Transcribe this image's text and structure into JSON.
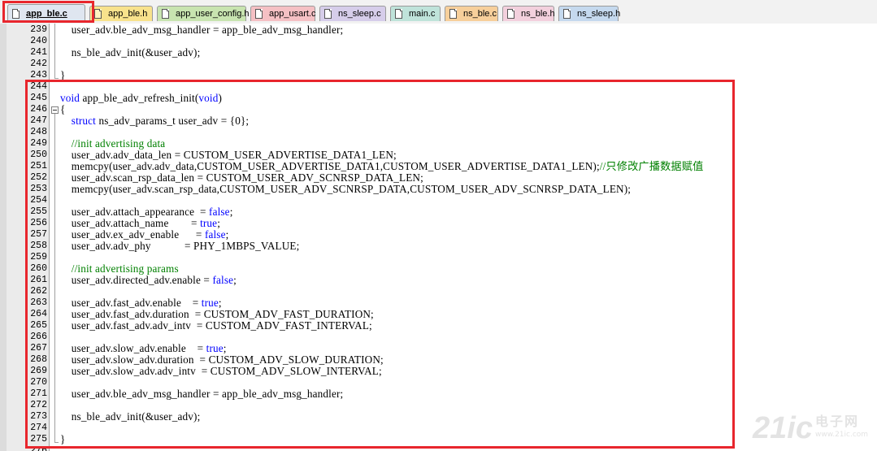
{
  "tabs": [
    {
      "label": "app_ble.c",
      "color": "#dfe6f0",
      "icon_color": "#ffffff",
      "active": true
    },
    {
      "label": "app_ble.h",
      "color": "#f8e28c",
      "icon_color": "#fff3c0",
      "active": false
    },
    {
      "label": "app_user_config.h",
      "color": "#c8e4b0",
      "icon_color": "#ffffff",
      "active": false
    },
    {
      "label": "app_usart.c",
      "color": "#f5c0c4",
      "icon_color": "#ffffff",
      "active": false
    },
    {
      "label": "ns_sleep.c",
      "color": "#d6cdea",
      "icon_color": "#ffffff",
      "active": false
    },
    {
      "label": "main.c",
      "color": "#bfe3da",
      "icon_color": "#ffffff",
      "active": false
    },
    {
      "label": "ns_ble.c",
      "color": "#f7cf9b",
      "icon_color": "#ffffff",
      "active": false
    },
    {
      "label": "ns_ble.h",
      "color": "#f3d0dd",
      "icon_color": "#ffffff",
      "active": false
    },
    {
      "label": "ns_sleep.h",
      "color": "#c5d9ee",
      "icon_color": "#ffffff",
      "active": false
    }
  ],
  "lines": [
    {
      "n": "239",
      "segs": [
        {
          "t": "    user_adv.ble_adv_msg_handler = app_ble_adv_msg_handler;",
          "c": "pl"
        }
      ]
    },
    {
      "n": "240",
      "segs": []
    },
    {
      "n": "241",
      "segs": [
        {
          "t": "    ns_ble_adv_init(&user_adv);",
          "c": "pl"
        }
      ]
    },
    {
      "n": "242",
      "segs": []
    },
    {
      "n": "243",
      "segs": [
        {
          "t": "}",
          "c": "pl"
        }
      ]
    },
    {
      "n": "244",
      "segs": []
    },
    {
      "n": "245",
      "segs": [
        {
          "t": "void",
          "c": "kw"
        },
        {
          "t": " app_ble_adv_refresh_init(",
          "c": "pl"
        },
        {
          "t": "void",
          "c": "kw"
        },
        {
          "t": ")",
          "c": "pl"
        }
      ]
    },
    {
      "n": "246",
      "segs": [
        {
          "t": "{",
          "c": "pl"
        }
      ]
    },
    {
      "n": "247",
      "segs": [
        {
          "t": "    ",
          "c": "pl"
        },
        {
          "t": "struct",
          "c": "kw"
        },
        {
          "t": " ns_adv_params_t user_adv = {0};",
          "c": "pl"
        }
      ]
    },
    {
      "n": "248",
      "segs": []
    },
    {
      "n": "249",
      "segs": [
        {
          "t": "    //init advertising data",
          "c": "cm"
        }
      ]
    },
    {
      "n": "250",
      "segs": [
        {
          "t": "    user_adv.adv_data_len = CUSTOM_USER_ADVERTISE_DATA1_LEN;",
          "c": "pl"
        }
      ]
    },
    {
      "n": "251",
      "segs": [
        {
          "t": "    memcpy(user_adv.adv_data,CUSTOM_USER_ADVERTISE_DATA1,CUSTOM_USER_ADVERTISE_DATA1_LEN);",
          "c": "pl"
        },
        {
          "t": "//只修改广播数据赋值",
          "c": "cm"
        }
      ]
    },
    {
      "n": "252",
      "segs": [
        {
          "t": "    user_adv.scan_rsp_data_len = CUSTOM_USER_ADV_SCNRSP_DATA_LEN;",
          "c": "pl"
        }
      ]
    },
    {
      "n": "253",
      "segs": [
        {
          "t": "    memcpy(user_adv.scan_rsp_data,CUSTOM_USER_ADV_SCNRSP_DATA,CUSTOM_USER_ADV_SCNRSP_DATA_LEN);",
          "c": "pl"
        }
      ]
    },
    {
      "n": "254",
      "segs": []
    },
    {
      "n": "255",
      "segs": [
        {
          "t": "    user_adv.attach_appearance  = ",
          "c": "pl"
        },
        {
          "t": "false",
          "c": "kw"
        },
        {
          "t": ";",
          "c": "pl"
        }
      ]
    },
    {
      "n": "256",
      "segs": [
        {
          "t": "    user_adv.attach_name        = ",
          "c": "pl"
        },
        {
          "t": "true",
          "c": "kw"
        },
        {
          "t": ";",
          "c": "pl"
        }
      ]
    },
    {
      "n": "257",
      "segs": [
        {
          "t": "    user_adv.ex_adv_enable      = ",
          "c": "pl"
        },
        {
          "t": "false",
          "c": "kw"
        },
        {
          "t": ";",
          "c": "pl"
        }
      ]
    },
    {
      "n": "258",
      "segs": [
        {
          "t": "    user_adv.adv_phy            = PHY_1MBPS_VALUE;",
          "c": "pl"
        }
      ]
    },
    {
      "n": "259",
      "segs": []
    },
    {
      "n": "260",
      "segs": [
        {
          "t": "    //init advertising params",
          "c": "cm"
        }
      ]
    },
    {
      "n": "261",
      "segs": [
        {
          "t": "    user_adv.directed_adv.enable = ",
          "c": "pl"
        },
        {
          "t": "false",
          "c": "kw"
        },
        {
          "t": ";",
          "c": "pl"
        }
      ]
    },
    {
      "n": "262",
      "segs": []
    },
    {
      "n": "263",
      "segs": [
        {
          "t": "    user_adv.fast_adv.enable    = ",
          "c": "pl"
        },
        {
          "t": "true",
          "c": "kw"
        },
        {
          "t": ";",
          "c": "pl"
        }
      ]
    },
    {
      "n": "264",
      "segs": [
        {
          "t": "    user_adv.fast_adv.duration  = CUSTOM_ADV_FAST_DURATION;",
          "c": "pl"
        }
      ]
    },
    {
      "n": "265",
      "segs": [
        {
          "t": "    user_adv.fast_adv.adv_intv  = CUSTOM_ADV_FAST_INTERVAL;",
          "c": "pl"
        }
      ]
    },
    {
      "n": "266",
      "segs": []
    },
    {
      "n": "267",
      "segs": [
        {
          "t": "    user_adv.slow_adv.enable    = ",
          "c": "pl"
        },
        {
          "t": "true",
          "c": "kw"
        },
        {
          "t": ";",
          "c": "pl"
        }
      ]
    },
    {
      "n": "268",
      "segs": [
        {
          "t": "    user_adv.slow_adv.duration  = CUSTOM_ADV_SLOW_DURATION;",
          "c": "pl"
        }
      ]
    },
    {
      "n": "269",
      "segs": [
        {
          "t": "    user_adv.slow_adv.adv_intv  = CUSTOM_ADV_SLOW_INTERVAL;",
          "c": "pl"
        }
      ]
    },
    {
      "n": "270",
      "segs": []
    },
    {
      "n": "271",
      "segs": [
        {
          "t": "    user_adv.ble_adv_msg_handler = app_ble_adv_msg_handler;",
          "c": "pl"
        }
      ]
    },
    {
      "n": "272",
      "segs": []
    },
    {
      "n": "273",
      "segs": [
        {
          "t": "    ns_ble_adv_init(&user_adv);",
          "c": "pl"
        }
      ]
    },
    {
      "n": "274",
      "segs": []
    },
    {
      "n": "275",
      "segs": [
        {
          "t": "}",
          "c": "pl"
        }
      ]
    },
    {
      "n": "276",
      "segs": []
    }
  ],
  "watermark": {
    "big": "21ic",
    "cn": "电子网",
    "url": "www.21ic.com"
  },
  "colors": {
    "keyword": "#0000ff",
    "comment": "#008000",
    "highlight_box": "#e8262d"
  }
}
